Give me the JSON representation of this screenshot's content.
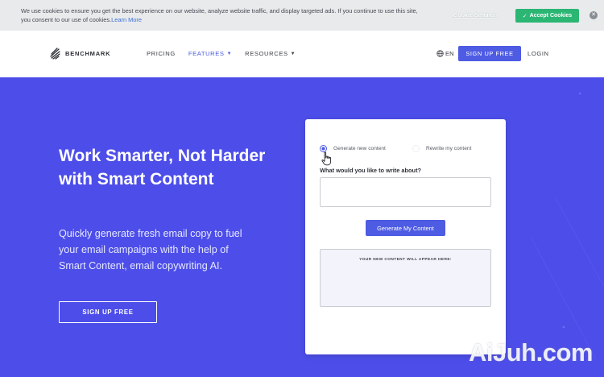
{
  "cookie_bar": {
    "message": "We use cookies to ensure you get the best experience on our website, analyze website traffic, and display targeted ads. If you continue to use this site, you consent to our use of cookies.",
    "learn_more": "Learn More",
    "settings_label": "Cookie Settings",
    "accept_label": "Accept Cookies",
    "accept_icon": "check-icon",
    "close_icon": "close-icon"
  },
  "header": {
    "logo_text": "BENCHMARK",
    "nav": [
      {
        "label": "PRICING",
        "active": false
      },
      {
        "label": "FEATURES",
        "active": true
      },
      {
        "label": "RESOURCES",
        "active": false
      }
    ],
    "language": "EN",
    "signup_label": "SIGN UP FREE",
    "login_label": "LOGIN"
  },
  "hero": {
    "headline": "Work Smarter, Not Harder with Smart Content",
    "subtext": "Quickly generate fresh email copy to fuel your email campaigns with the help of Smart Content, email copywriting AI.",
    "signup_label": "SIGN UP FREE"
  },
  "card": {
    "option_new": "Generate new content",
    "option_rewrite": "Rewrite my content",
    "selected_option": "Generate new content",
    "question": "What would you like to write about?",
    "input_value": "",
    "generate_label": "Generate My Content",
    "output_placeholder": "YOUR NEW CONTENT WILL APPEAR HERE:"
  },
  "watermark": "AiJuh.com",
  "colors": {
    "hero_bg": "#4d4ee9",
    "accent": "#4e5be3",
    "accept_green": "#2bb673",
    "cookie_bg": "#e9eaec"
  }
}
